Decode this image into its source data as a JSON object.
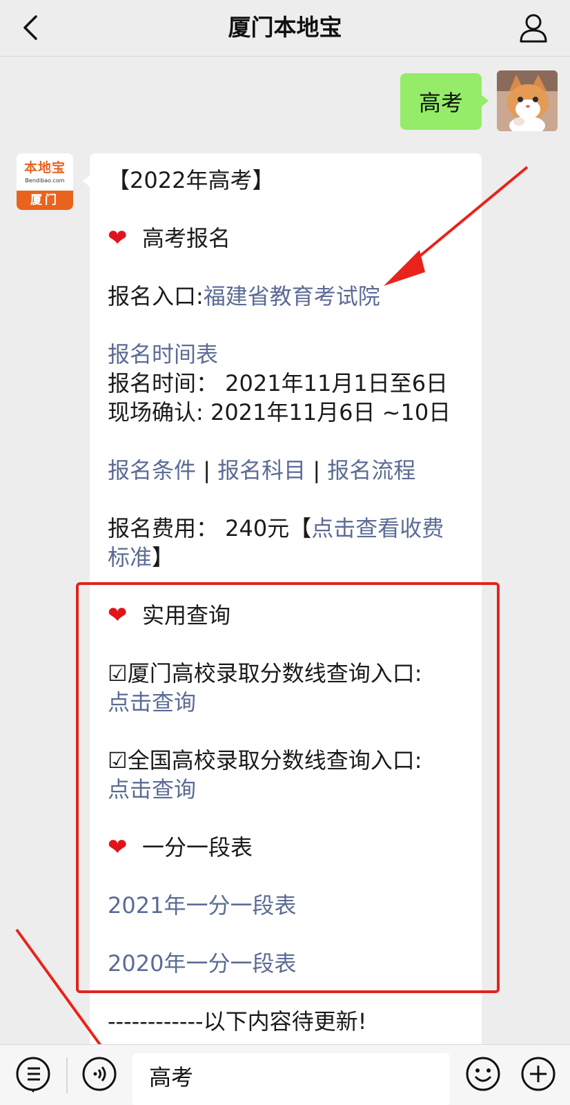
{
  "header": {
    "title": "厦门本地宝"
  },
  "user_message": {
    "text": "高考"
  },
  "bot": {
    "avatar": {
      "brand": "本地宝",
      "sub": "Bendibao.com",
      "city": "厦门"
    },
    "title": "【2022年高考】",
    "sec1_title": "高考报名",
    "entry_label": "报名入口:",
    "entry_link": "福建省教育考试院",
    "schedule_link": "报名时间表",
    "time_line": "报名时间： 2021年11月1日至6日",
    "confirm_line": "现场确认: 2021年11月6日 ~10日",
    "cond_link": "报名条件",
    "subject_link": "报名科目",
    "flow_link": "报名流程",
    "sep": " | ",
    "fee_prefix": "报名费用： 240元【",
    "fee_link_1": "点击查看收费",
    "fee_link_2": "标准",
    "fee_suffix": "】",
    "sec2_title": "实用查询",
    "xm_query": "☑厦门高校录取分数线查询入口:",
    "xm_link": "点击查询",
    "cn_query": "☑全国高校录取分数线查询入口:",
    "cn_link": "点击查询",
    "sec3_title": "一分一段表",
    "y2021_link": "2021年一分一段表",
    "y2020_link": "2020年一分一段表",
    "pending": "------------以下内容待更新!"
  },
  "input": {
    "value": "高考"
  },
  "icons": {
    "heart": "❤",
    "back": "chevron-left-icon",
    "profile": "person-icon",
    "menu": "list-icon",
    "voice": "voice-icon",
    "emoji": "smile-icon",
    "plus": "plus-icon"
  },
  "colors": {
    "link": "#5b6b94",
    "user_bubble": "#95ec69",
    "highlight": "#e0231c",
    "brand": "#e8641e"
  }
}
